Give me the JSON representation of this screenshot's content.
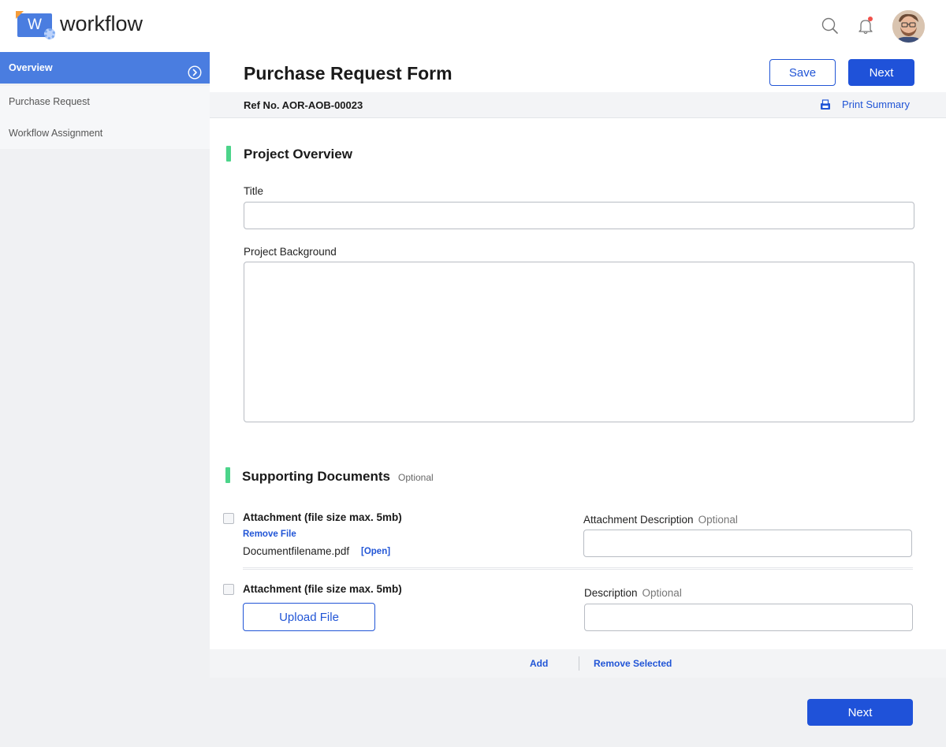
{
  "app": {
    "name": "workflow",
    "logo_letter": "W"
  },
  "header": {
    "search_icon": "search-icon",
    "bell_icon": "bell-icon",
    "notification_dot_color": "#f0504a"
  },
  "sidebar": {
    "items": [
      {
        "label": "Overview",
        "active": true
      },
      {
        "label": "Purchase Request",
        "active": false
      },
      {
        "label": "Workflow Assignment",
        "active": false
      }
    ]
  },
  "form": {
    "title": "Purchase Request Form",
    "save_label": "Save",
    "next_label": "Next",
    "ref_no": "Ref No. AOR-AOB-00023",
    "print_summary": "Print Summary"
  },
  "project_overview": {
    "heading": "Project Overview",
    "title_label": "Title",
    "title_value": "",
    "background_label": "Project Background",
    "background_value": ""
  },
  "supporting_documents": {
    "heading": "Supporting Documents",
    "optional": "Optional",
    "attachments": [
      {
        "title": "Attachment (file size max. 5mb)",
        "remove_label": "Remove File",
        "filename": "Documentfilename.pdf",
        "open_label": "[Open]",
        "desc_label": "Attachment Description",
        "desc_optional": "Optional",
        "desc_value": ""
      },
      {
        "title": "Attachment (file size max. 5mb)",
        "upload_label": "Upload File",
        "desc_label": "Description",
        "desc_optional": "Optional",
        "desc_value": ""
      }
    ],
    "add_label": "Add",
    "remove_selected_label": "Remove Selected"
  },
  "footer": {
    "next_label": "Next"
  },
  "colors": {
    "primary": "#1f52d9",
    "sidebar_active": "#4a7de0",
    "section_accent": "#4cd48a"
  }
}
